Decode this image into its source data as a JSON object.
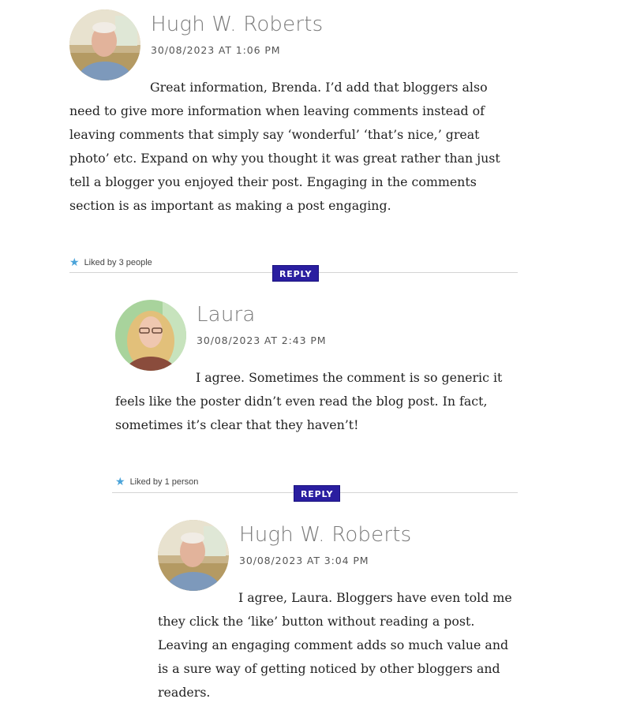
{
  "comments": [
    {
      "author": "Hugh W. Roberts",
      "date": "30/08/2023 AT 1:06 PM",
      "text": "Great information, Brenda. I’d add that bloggers also need to give more information when leaving comments instead of leaving comments that simply say ‘wonderful’ ‘that’s nice,’ great photo’ etc. Expand on why you thought it was great rather than just tell a blogger you enjoyed their post. Engaging in the comments section is as important as making a post engaging.",
      "likes": "Liked by 3 people",
      "reply": "REPLY"
    },
    {
      "author": "Laura",
      "date": "30/08/2023 AT 2:43 PM",
      "text": "I agree. Sometimes the comment is so generic it feels like the poster didn’t even read the blog post. In fact, sometimes it’s clear that they haven’t!",
      "likes": "Liked by 1 person",
      "reply": "REPLY"
    },
    {
      "author": "Hugh W. Roberts",
      "date": "30/08/2023 AT 3:04 PM",
      "text": "I agree, Laura. Bloggers have even told me they click the ‘like’ button without reading a post. Leaving an engaging comment adds so much value and is a sure way of getting noticed by other bloggers and readers."
    }
  ],
  "icons": {
    "like": "star-icon"
  },
  "colors": {
    "reply_bg": "#2a1ea0",
    "star": "#4aa3d9",
    "author": "#7a7a7a"
  }
}
